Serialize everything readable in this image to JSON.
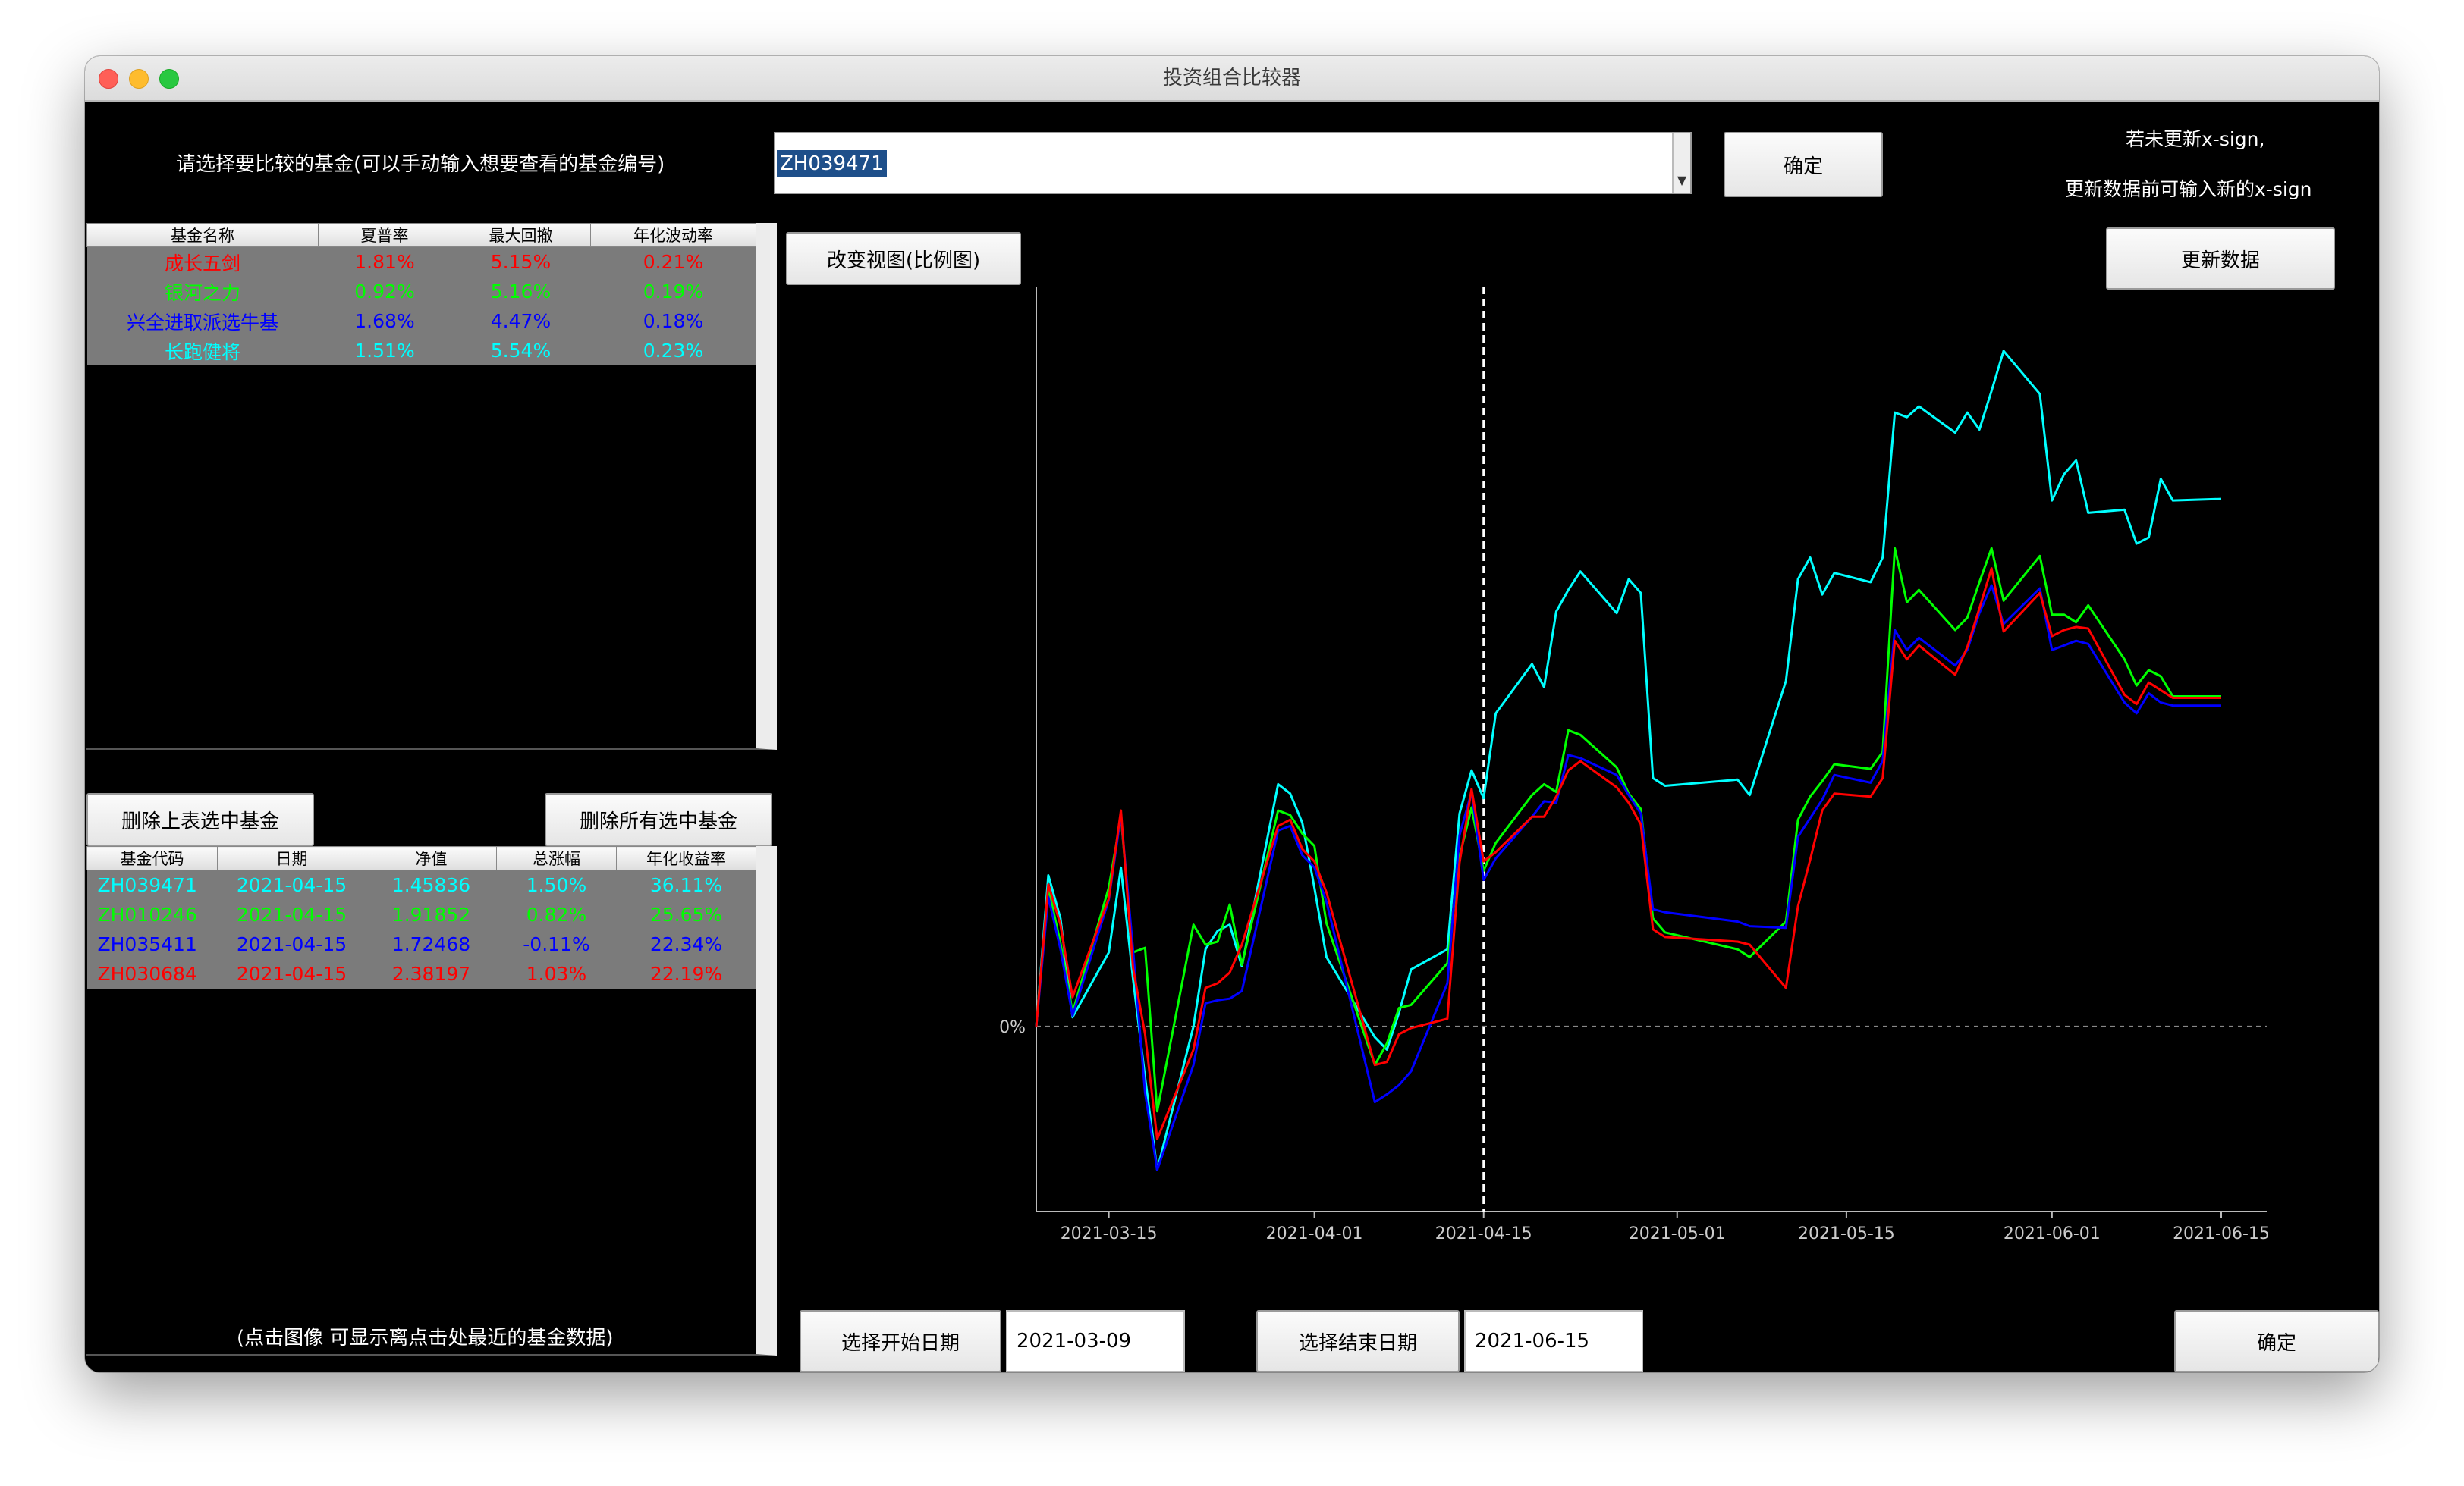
{
  "window": {
    "title": "投资组合比较器"
  },
  "top": {
    "instruction": "请选择要比较的基金(可以手动输入想要查看的基金编号)",
    "fund_input_value": "ZH039471",
    "confirm_label": "确定",
    "xsign_line1": "若未更新x-sign,",
    "xsign_line2": "更新数据前可输入新的x-sign",
    "update_label": "更新数据",
    "view_toggle_label": "改变视图(比例图)"
  },
  "stats_table": {
    "headers": [
      "基金名称",
      "夏普率",
      "最大回撤",
      "年化波动率"
    ],
    "rows": [
      {
        "name": "成长五剑",
        "sharpe": "1.81%",
        "max_drawdown": "5.15%",
        "volatility": "0.21%",
        "color": "#ff0000"
      },
      {
        "name": "银河之力",
        "sharpe": "0.92%",
        "max_drawdown": "5.16%",
        "volatility": "0.19%",
        "color": "#00ff00"
      },
      {
        "name": "兴全进取派选牛基",
        "sharpe": "1.68%",
        "max_drawdown": "4.47%",
        "volatility": "0.18%",
        "color": "#0000ff"
      },
      {
        "name": "长跑健将",
        "sharpe": "1.51%",
        "max_drawdown": "5.54%",
        "volatility": "0.23%",
        "color": "#00ffff"
      }
    ]
  },
  "delete_selected_label": "删除上表选中基金",
  "delete_all_label": "删除所有选中基金",
  "nav_table": {
    "headers": [
      "基金代码",
      "日期",
      "净值",
      "总涨幅",
      "年化收益率"
    ],
    "rows": [
      {
        "code": "ZH039471",
        "date": "2021-04-15",
        "nav": "1.45836",
        "total": "1.50%",
        "annual": "36.11%",
        "color": "#00ffff"
      },
      {
        "code": "ZH010246",
        "date": "2021-04-15",
        "nav": "1.91852",
        "total": "0.82%",
        "annual": "25.65%",
        "color": "#00ff00"
      },
      {
        "code": "ZH035411",
        "date": "2021-04-15",
        "nav": "1.72468",
        "total": "-0.11%",
        "annual": "22.34%",
        "color": "#0000ff"
      },
      {
        "code": "ZH030684",
        "date": "2021-04-15",
        "nav": "2.38197",
        "total": "1.03%",
        "annual": "22.19%",
        "color": "#ff0000"
      }
    ]
  },
  "hint": "(点击图像 可显示离点击处最近的基金数据)",
  "start_date_label": "选择开始日期",
  "start_date_value": "2021-03-09",
  "end_date_label": "选择结束日期",
  "end_date_value": "2021-06-15",
  "bottom_confirm_label": "确定",
  "chart_data": {
    "type": "line",
    "x_ticks": [
      "2021-03-15",
      "2021-04-01",
      "2021-04-15",
      "2021-05-01",
      "2021-05-15",
      "2021-06-01",
      "2021-06-15"
    ],
    "y_tick_label": "0%",
    "x_range": [
      "2021-03-09",
      "2021-06-15"
    ],
    "y_range": [
      -12,
      46
    ],
    "marker_date": "2021-04-15",
    "x": [
      "2021-03-09",
      "2021-03-10",
      "2021-03-11",
      "2021-03-12",
      "2021-03-15",
      "2021-03-16",
      "2021-03-17",
      "2021-03-18",
      "2021-03-19",
      "2021-03-22",
      "2021-03-23",
      "2021-03-24",
      "2021-03-25",
      "2021-03-26",
      "2021-03-29",
      "2021-03-30",
      "2021-03-31",
      "2021-04-01",
      "2021-04-02",
      "2021-04-06",
      "2021-04-07",
      "2021-04-08",
      "2021-04-09",
      "2021-04-12",
      "2021-04-13",
      "2021-04-14",
      "2021-04-15",
      "2021-04-16",
      "2021-04-19",
      "2021-04-20",
      "2021-04-21",
      "2021-04-22",
      "2021-04-23",
      "2021-04-26",
      "2021-04-27",
      "2021-04-28",
      "2021-04-29",
      "2021-04-30",
      "2021-05-06",
      "2021-05-07",
      "2021-05-10",
      "2021-05-11",
      "2021-05-12",
      "2021-05-13",
      "2021-05-14",
      "2021-05-17",
      "2021-05-18",
      "2021-05-19",
      "2021-05-20",
      "2021-05-21",
      "2021-05-24",
      "2021-05-25",
      "2021-05-26",
      "2021-05-27",
      "2021-05-28",
      "2021-05-31",
      "2021-06-01",
      "2021-06-02",
      "2021-06-03",
      "2021-06-04",
      "2021-06-07",
      "2021-06-08",
      "2021-06-09",
      "2021-06-10",
      "2021-06-11",
      "2021-06-15"
    ],
    "series": [
      {
        "color": "#00ffff",
        "values": [
          0,
          9.8,
          7.0,
          0.6,
          4.8,
          10.3,
          3.1,
          -3.3,
          -9.3,
          0,
          5.0,
          6.2,
          6.6,
          3.9,
          15.7,
          15.1,
          13.2,
          9.0,
          4.5,
          -0.7,
          -1.5,
          0.9,
          3.7,
          5.0,
          13.8,
          16.6,
          14.8,
          20.3,
          23.5,
          22.0,
          26.9,
          28.3,
          29.5,
          26.8,
          29.0,
          28.1,
          16.1,
          15.6,
          16.0,
          15.0,
          22.4,
          29.0,
          30.4,
          28.0,
          29.4,
          28.8,
          30.4,
          39.8,
          39.5,
          40.2,
          38.5,
          39.8,
          38.7,
          41.2,
          43.8,
          41.0,
          34.1,
          35.8,
          36.7,
          33.3,
          33.5,
          31.3,
          31.7,
          35.5,
          34.1,
          34.2
        ]
      },
      {
        "color": "#00ff00",
        "values": [
          0,
          9.0,
          5.4,
          0.9,
          9.0,
          13.6,
          4.8,
          5.1,
          -5.5,
          6.6,
          5.3,
          5.5,
          7.9,
          4.0,
          14.0,
          13.7,
          12.5,
          11.7,
          6.7,
          -2.5,
          -1.1,
          1.2,
          1.4,
          4.1,
          11.0,
          14.2,
          10.1,
          11.9,
          15.0,
          15.7,
          15.2,
          19.2,
          18.9,
          16.8,
          15.1,
          14.1,
          7.0,
          6.1,
          5.0,
          4.5,
          6.8,
          13.4,
          14.9,
          15.9,
          17.0,
          16.7,
          17.8,
          31.0,
          27.5,
          28.3,
          25.7,
          26.5,
          28.8,
          31.0,
          27.6,
          30.5,
          26.7,
          26.7,
          26.2,
          27.3,
          23.8,
          22.1,
          23.1,
          22.7,
          21.4,
          21.4
        ]
      },
      {
        "color": "#0000ff",
        "values": [
          0,
          8.4,
          5.0,
          0.7,
          8.2,
          13.7,
          5.0,
          -4.3,
          -9.3,
          -2.5,
          1.5,
          1.7,
          1.8,
          2.3,
          12.7,
          13.0,
          11.1,
          10.3,
          8.1,
          -4.9,
          -4.4,
          -3.8,
          -2.9,
          2.8,
          12.4,
          15.2,
          9.5,
          10.9,
          13.6,
          14.6,
          14.5,
          17.6,
          17.4,
          16.3,
          15.0,
          13.8,
          7.6,
          7.4,
          6.8,
          6.5,
          6.4,
          12.3,
          13.5,
          14.7,
          16.3,
          15.8,
          17.2,
          25.7,
          24.4,
          25.2,
          23.4,
          24.4,
          26.8,
          28.6,
          26.1,
          28.4,
          24.4,
          24.7,
          25.0,
          24.8,
          21.0,
          20.3,
          21.6,
          21.0,
          20.8,
          20.8
        ]
      },
      {
        "color": "#ff0000",
        "values": [
          0,
          9.2,
          6.6,
          1.9,
          8.3,
          14.0,
          3.8,
          -0.5,
          -7.3,
          -1.5,
          2.5,
          2.8,
          3.5,
          5.3,
          13.0,
          13.4,
          11.5,
          10.7,
          8.7,
          -2.5,
          -2.3,
          -0.5,
          -0.1,
          0.5,
          10.6,
          15.4,
          10.7,
          11.3,
          13.6,
          13.6,
          14.9,
          16.6,
          17.2,
          15.5,
          14.5,
          13.1,
          6.3,
          5.8,
          5.5,
          5.3,
          2.5,
          7.8,
          10.8,
          14.0,
          15.1,
          14.9,
          16.1,
          25.0,
          23.8,
          24.7,
          22.8,
          24.6,
          27.1,
          29.7,
          25.6,
          28.1,
          25.3,
          25.7,
          25.9,
          25.8,
          21.5,
          20.9,
          22.3,
          21.8,
          21.3,
          21.3
        ]
      }
    ]
  }
}
